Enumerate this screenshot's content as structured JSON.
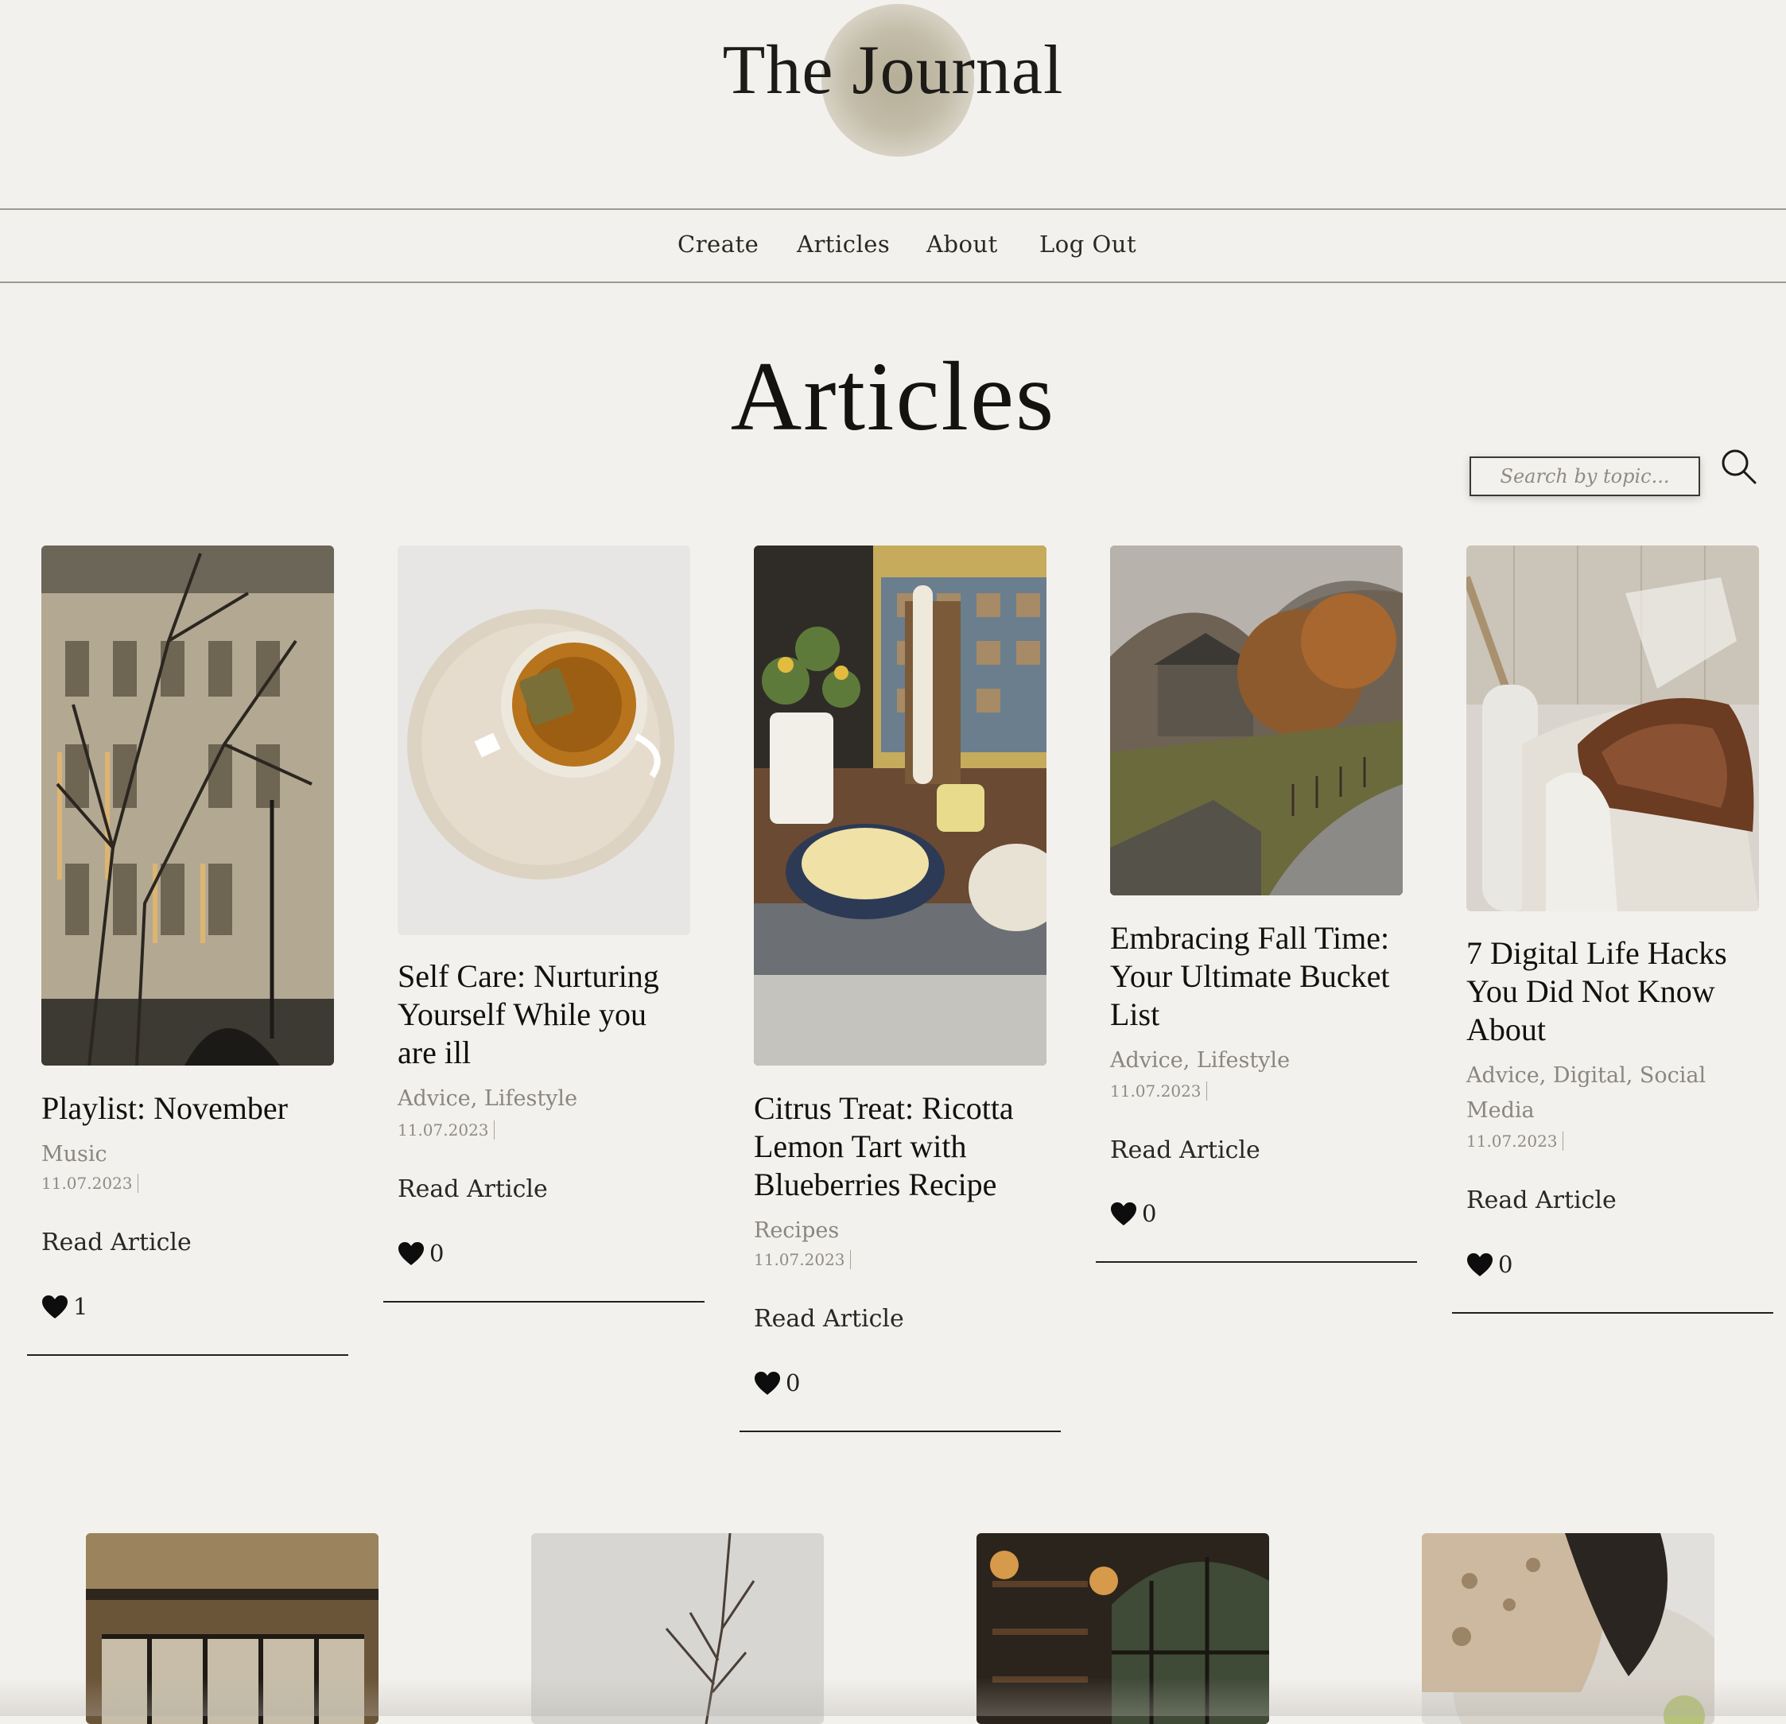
{
  "site": {
    "title": "The Journal"
  },
  "nav": {
    "items": [
      "Create",
      "Articles",
      "About",
      "Log Out"
    ]
  },
  "page": {
    "heading": "Articles"
  },
  "search": {
    "placeholder": "Search by topic...",
    "icon": "search-icon"
  },
  "articles": [
    {
      "title": "Playlist: November",
      "topics": "Music",
      "date": "11.07.2023",
      "read_label": "Read Article",
      "likes": "1",
      "image": "city-building-with-bare-trees"
    },
    {
      "title": "Self Care: Nurturing Yourself While you are ill",
      "topics": "Advice, Lifestyle",
      "date": "11.07.2023",
      "read_label": "Read Article",
      "likes": "0",
      "image": "tea-cup-on-marble-plate"
    },
    {
      "title": "Citrus Treat: Ricotta Lemon Tart with Blueberries Recipe",
      "topics": "Recipes",
      "date": "11.07.2023",
      "read_label": "Read Article",
      "likes": "0",
      "image": "kitchen-counter-tart-baking"
    },
    {
      "title": "Embracing Fall Time: Your Ultimate Bucket List",
      "topics": "Advice, Lifestyle",
      "date": "11.07.2023",
      "read_label": "Read Article",
      "likes": "0",
      "image": "stone-cottage-autumn-lane"
    },
    {
      "title": "7 Digital Life Hacks You Did Not Know About",
      "topics": "Advice, Digital, Social Media",
      "date": "11.07.2023",
      "read_label": "Read Article",
      "likes": "0",
      "image": "cozy-sofa-with-fur-throw"
    }
  ],
  "next_row_images": [
    "wooden-ceiling-window",
    "bare-branch-in-vase",
    "dark-cafe-interior",
    "sourdough-bread-loaf"
  ],
  "colors": {
    "background": "#f3f1ed",
    "text": "#111111",
    "muted": "#8a8680",
    "logo_blob": "#b5ae98"
  }
}
